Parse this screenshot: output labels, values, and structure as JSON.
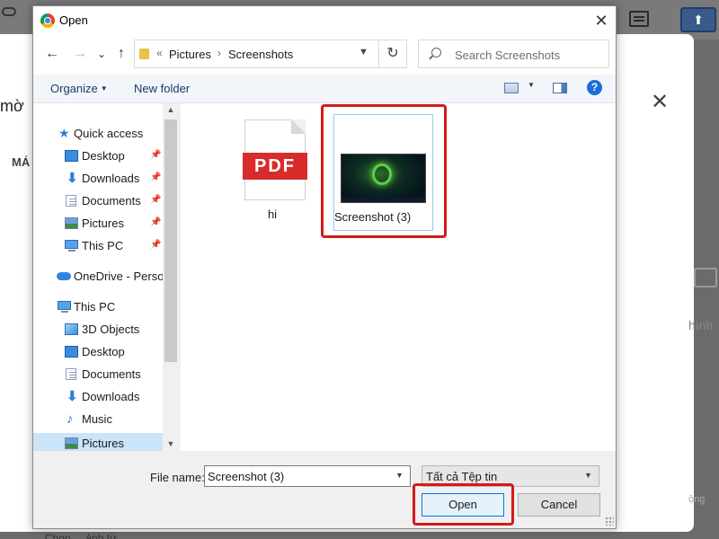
{
  "background": {
    "card_title": "mờ",
    "card_label": "MÁ",
    "right_text": "hình",
    "right_text2": "ộng",
    "bottom_text": "Chọn ... ảnh từ ...",
    "icons": [
      "cloud-icon",
      "chat-icon",
      "upload-icon",
      "close-icon",
      "image-icon"
    ]
  },
  "dialog": {
    "title": "Open",
    "close_label": "✕",
    "nav": {
      "back": "←",
      "forward": "→",
      "dropdown": "⌄",
      "up": "↑",
      "refresh": "↻"
    },
    "address": {
      "overflow": "«",
      "segments": [
        "Pictures",
        "Screenshots"
      ],
      "separator": "›"
    },
    "search": {
      "placeholder": "Search Screenshots"
    },
    "toolbar": {
      "organize": "Organize",
      "new_folder": "New folder",
      "help": "?"
    },
    "nav_pane": {
      "items": [
        {
          "label": "Quick access",
          "icon": "star-icon",
          "pinned": false
        },
        {
          "label": "Desktop",
          "icon": "desktop-icon",
          "pinned": true
        },
        {
          "label": "Downloads",
          "icon": "download-icon",
          "pinned": true
        },
        {
          "label": "Documents",
          "icon": "document-icon",
          "pinned": true
        },
        {
          "label": "Pictures",
          "icon": "pictures-icon",
          "pinned": true
        },
        {
          "label": "This PC",
          "icon": "computer-icon",
          "pinned": true
        },
        {
          "label": "OneDrive - Persor",
          "icon": "cloud-icon",
          "pinned": false
        },
        {
          "label": "This PC",
          "icon": "computer-icon",
          "pinned": false
        },
        {
          "label": "3D Objects",
          "icon": "cube-icon",
          "pinned": false
        },
        {
          "label": "Desktop",
          "icon": "desktop-icon",
          "pinned": false
        },
        {
          "label": "Documents",
          "icon": "document-icon",
          "pinned": false
        },
        {
          "label": "Downloads",
          "icon": "download-icon",
          "pinned": false
        },
        {
          "label": "Music",
          "icon": "music-icon",
          "pinned": false
        },
        {
          "label": "Pictures",
          "icon": "pictures-icon",
          "pinned": false,
          "selected": true
        }
      ]
    },
    "files": [
      {
        "name": "hi",
        "type": "pdf",
        "badge": "PDF"
      },
      {
        "name": "Screenshot (3)",
        "type": "image",
        "selected": true
      }
    ],
    "file_name": {
      "label": "File name:",
      "value": "Screenshot (3)"
    },
    "file_type": {
      "value": "Tất cả Tệp tin"
    },
    "buttons": {
      "open": "Open",
      "cancel": "Cancel"
    },
    "highlight_color": "#d41a1a"
  }
}
